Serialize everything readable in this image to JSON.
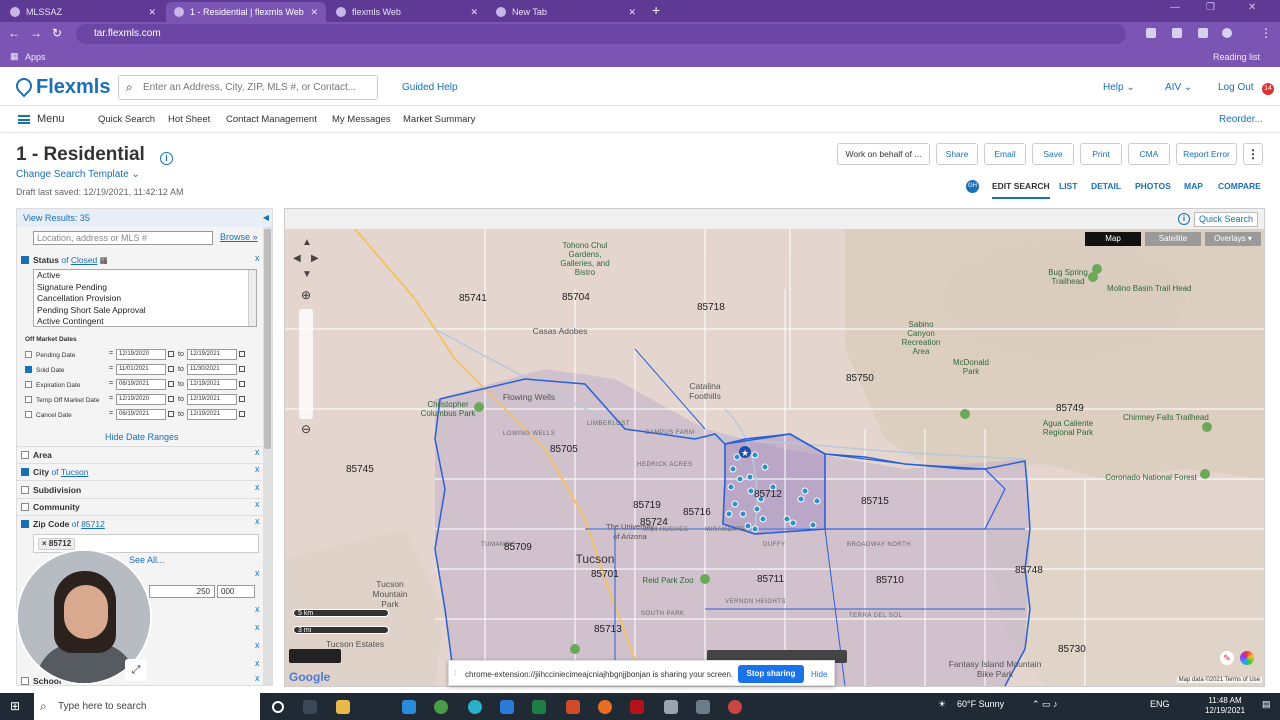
{
  "browser": {
    "tabs": [
      {
        "label": "MLSSAZ",
        "active": false
      },
      {
        "label": "1 - Residential | flexmls Web",
        "active": true
      },
      {
        "label": "flexmls Web",
        "active": false
      },
      {
        "label": "New Tab",
        "active": false
      }
    ],
    "url": "tar.flexmls.com",
    "bookmarks_apps": "Apps",
    "reading_list": "Reading list"
  },
  "header": {
    "logo": "Flexmls",
    "search_placeholder": "Enter an Address, City, ZIP, MLS #, or Contact...",
    "guided_help": "Guided Help",
    "help": "Help",
    "user": "AIV",
    "logout": "Log Out",
    "notif_count": "14"
  },
  "subnav": {
    "menu": "Menu",
    "items": [
      "Quick Search",
      "Hot Sheet",
      "Contact Management",
      "My Messages",
      "Market Summary"
    ],
    "reorder": "Reorder..."
  },
  "page": {
    "title": "1 - Residential",
    "change_template": "Change Search Template",
    "draft": "Draft last saved: 12/19/2021, 11:42:12 AM"
  },
  "actions": [
    "Work on behalf of ...",
    "Share",
    "Email",
    "Save",
    "Print",
    "CMA",
    "Report Error"
  ],
  "view_tabs": {
    "badge": "GH",
    "items": [
      "EDIT SEARCH",
      "LIST",
      "DETAIL",
      "PHOTOS",
      "MAP",
      "COMPARE"
    ],
    "active": "EDIT SEARCH"
  },
  "left_panel": {
    "view_results": "View Results: 35",
    "location_placeholder": "Location, address or MLS #",
    "browse": "Browse »",
    "status": {
      "label": "Status",
      "of": "of",
      "value": "Closed"
    },
    "status_options": [
      "Active",
      "Signature Pending",
      "Cancellation Provision",
      "Pending Short Sale Approval",
      "Active Contingent"
    ],
    "off_market_title": "Off Market Dates",
    "date_rows": [
      {
        "label": "Pending Date",
        "from": "12/19/2020",
        "to": "12/19/2021",
        "checked": false
      },
      {
        "label": "Sold Date",
        "from": "11/01/2021",
        "to": "11/30/2021",
        "checked": true
      },
      {
        "label": "Expiration Date",
        "from": "06/19/2021",
        "to": "12/19/2021",
        "checked": false
      },
      {
        "label": "Temp Off Market Date",
        "from": "12/19/2020",
        "to": "12/19/2021",
        "checked": false
      },
      {
        "label": "Cancel Date",
        "from": "06/19/2021",
        "to": "12/19/2021",
        "checked": false
      }
    ],
    "to_word": "to",
    "hide_date_ranges": "Hide Date Ranges",
    "area": "Area",
    "city": {
      "label": "City",
      "of": "of",
      "value": "Tucson"
    },
    "subdivision": "Subdivision",
    "community": "Community",
    "zip": {
      "label": "Zip Code",
      "of": "of",
      "value": "85712"
    },
    "zip_chip": "85712",
    "see_all": "See All...",
    "price_min": "250",
    "price_max": "000",
    "school": "School",
    "x": "x"
  },
  "map": {
    "quick_search": "Quick Search",
    "types": [
      "Map",
      "Satellite",
      "Overlays ▾"
    ],
    "zips": [
      {
        "t": "85741"
      },
      {
        "t": "85704"
      },
      {
        "t": "85718"
      },
      {
        "t": "85750"
      },
      {
        "t": "85749"
      },
      {
        "t": "85745"
      },
      {
        "t": "85705"
      },
      {
        "t": "85712"
      },
      {
        "t": "85715"
      },
      {
        "t": "85719"
      },
      {
        "t": "85716"
      },
      {
        "t": "85724"
      },
      {
        "t": "85709"
      },
      {
        "t": "85701"
      },
      {
        "t": "85711"
      },
      {
        "t": "85710"
      },
      {
        "t": "85748"
      },
      {
        "t": "85713"
      },
      {
        "t": "85730"
      }
    ],
    "places": [
      "Tohono Chul Gardens, Galleries, and Bistro",
      "Bug Spring Trailhead",
      "Molino Basin Trail Head",
      "Sabino Canyon Recreation Area",
      "McDonald Park",
      "Agua Caliente Regional Park",
      "Chimney Falls Trailhead",
      "Coronado National Forest",
      "Christopher Columbus Park",
      "Catalina Foothills",
      "Casas Adobes",
      "Flowing Wells",
      "Tucson",
      "The University of Arizona",
      "Reid Park Zoo",
      "Tucson Mountain Park",
      "Tucson Estates",
      "Fantasy Island Mountain Bike Park"
    ],
    "neighborhoods": [
      "LIMBERLOST",
      "CAMPUS FARM",
      "HEDRICK ACRES",
      "BROADWAY NORTH",
      "DUFFY",
      "SAM HUGHES",
      "MIRAMONTE",
      "VERNON HEIGHTS",
      "SOUTH PARK",
      "TERRA DEL SOL",
      "LOWING WELLS",
      "TUMAMOC"
    ],
    "scale_km": "5 km",
    "scale_mi": "3 mi",
    "google": "Google",
    "map_data": "Map data ©2021   Terms of Use"
  },
  "sharing_bar": {
    "text": "chrome-extension://jiihcciniecimeajcniajhbgnjjbonjan is sharing your screen.",
    "stop": "Stop sharing",
    "hide": "Hide"
  },
  "taskbar": {
    "search": "Type here to search",
    "weather": "60°F  Sunny",
    "lang": "ENG",
    "time": "11:48 AM",
    "date": "12/19/2021"
  }
}
